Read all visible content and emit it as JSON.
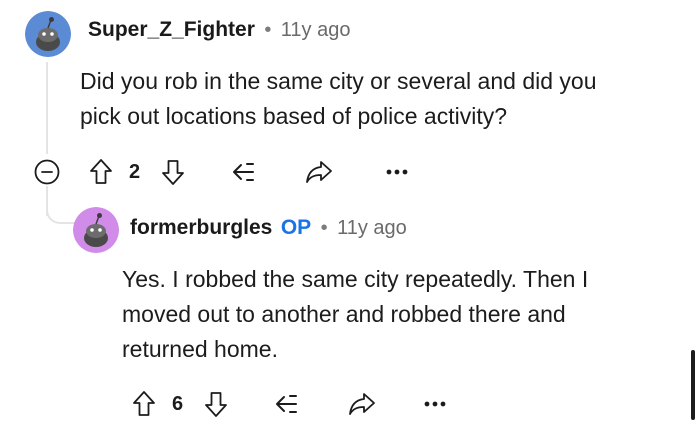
{
  "comment_1": {
    "username": "Super_Z_Fighter",
    "separator": "•",
    "time": "11y ago",
    "body_line_1": "Did you rob in the same city or several and did you",
    "body_line_2": "pick out locations based of police activity?",
    "vote_count": "2",
    "avatar_color": "#5b8bd4"
  },
  "reply_1": {
    "username": "formerburgles",
    "op_badge": "OP",
    "separator": "•",
    "time": "11y ago",
    "body_line_1": "Yes. I robbed the same city repeatedly. Then I",
    "body_line_2": "moved out to another and robbed there and",
    "body_line_3": "returned home.",
    "vote_count": "6",
    "avatar_color": "#d08ce8"
  },
  "colors": {
    "op_blue": "#1a73e8",
    "thread_line": "#e4e4e4",
    "icon": "#1c1c1c"
  }
}
